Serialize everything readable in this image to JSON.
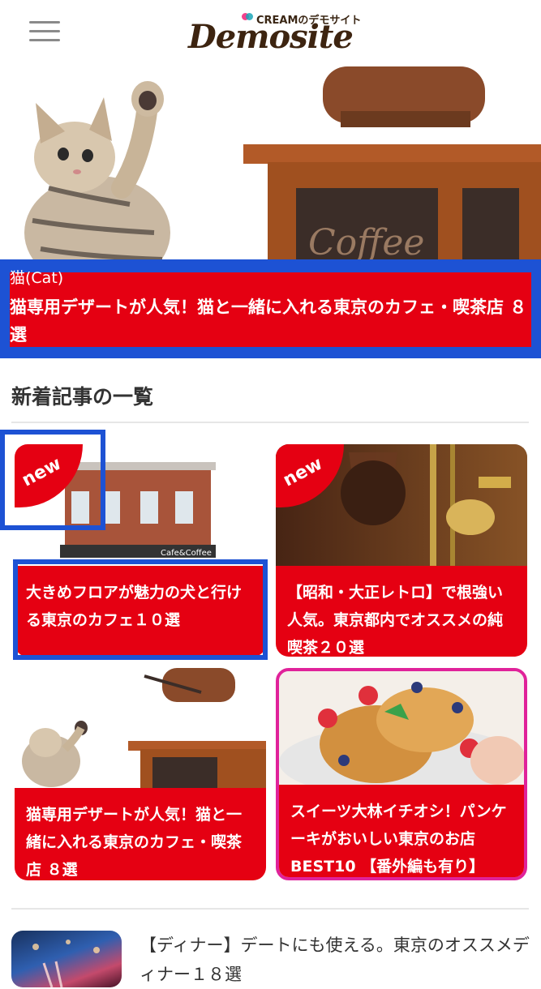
{
  "header": {
    "logo_subtitle": "CREAMのデモサイト",
    "logo_text": "Demosite"
  },
  "hero": {
    "category": "猫(Cat)",
    "title": "猫専用デザートが人気！猫と一緒に入れる東京のカフェ・喫茶店 ８選"
  },
  "section": {
    "title": "新着記事の一覧"
  },
  "cards": [
    {
      "title": "大きめフロアが魅力の犬と行ける東京のカフェ１０選",
      "badge": "new"
    },
    {
      "title": "【昭和・大正レトロ】で根強い人気。東京都内でオススメの純喫茶２０選",
      "badge": "new"
    },
    {
      "title": "猫専用デザートが人気！猫と一緒に入れる東京のカフェ・喫茶店 ８選"
    },
    {
      "title": "スイーツ大林イチオシ！パンケーキがおいしい東京のお店BEST10 【番外編も有り】"
    }
  ],
  "list": [
    {
      "title": "【ディナー】デートにも使える。東京のオススメディナー１８選"
    }
  ],
  "colors": {
    "accent_red": "#e50012",
    "highlight_blue": "#1d52d4",
    "brown": "#3d2410"
  }
}
